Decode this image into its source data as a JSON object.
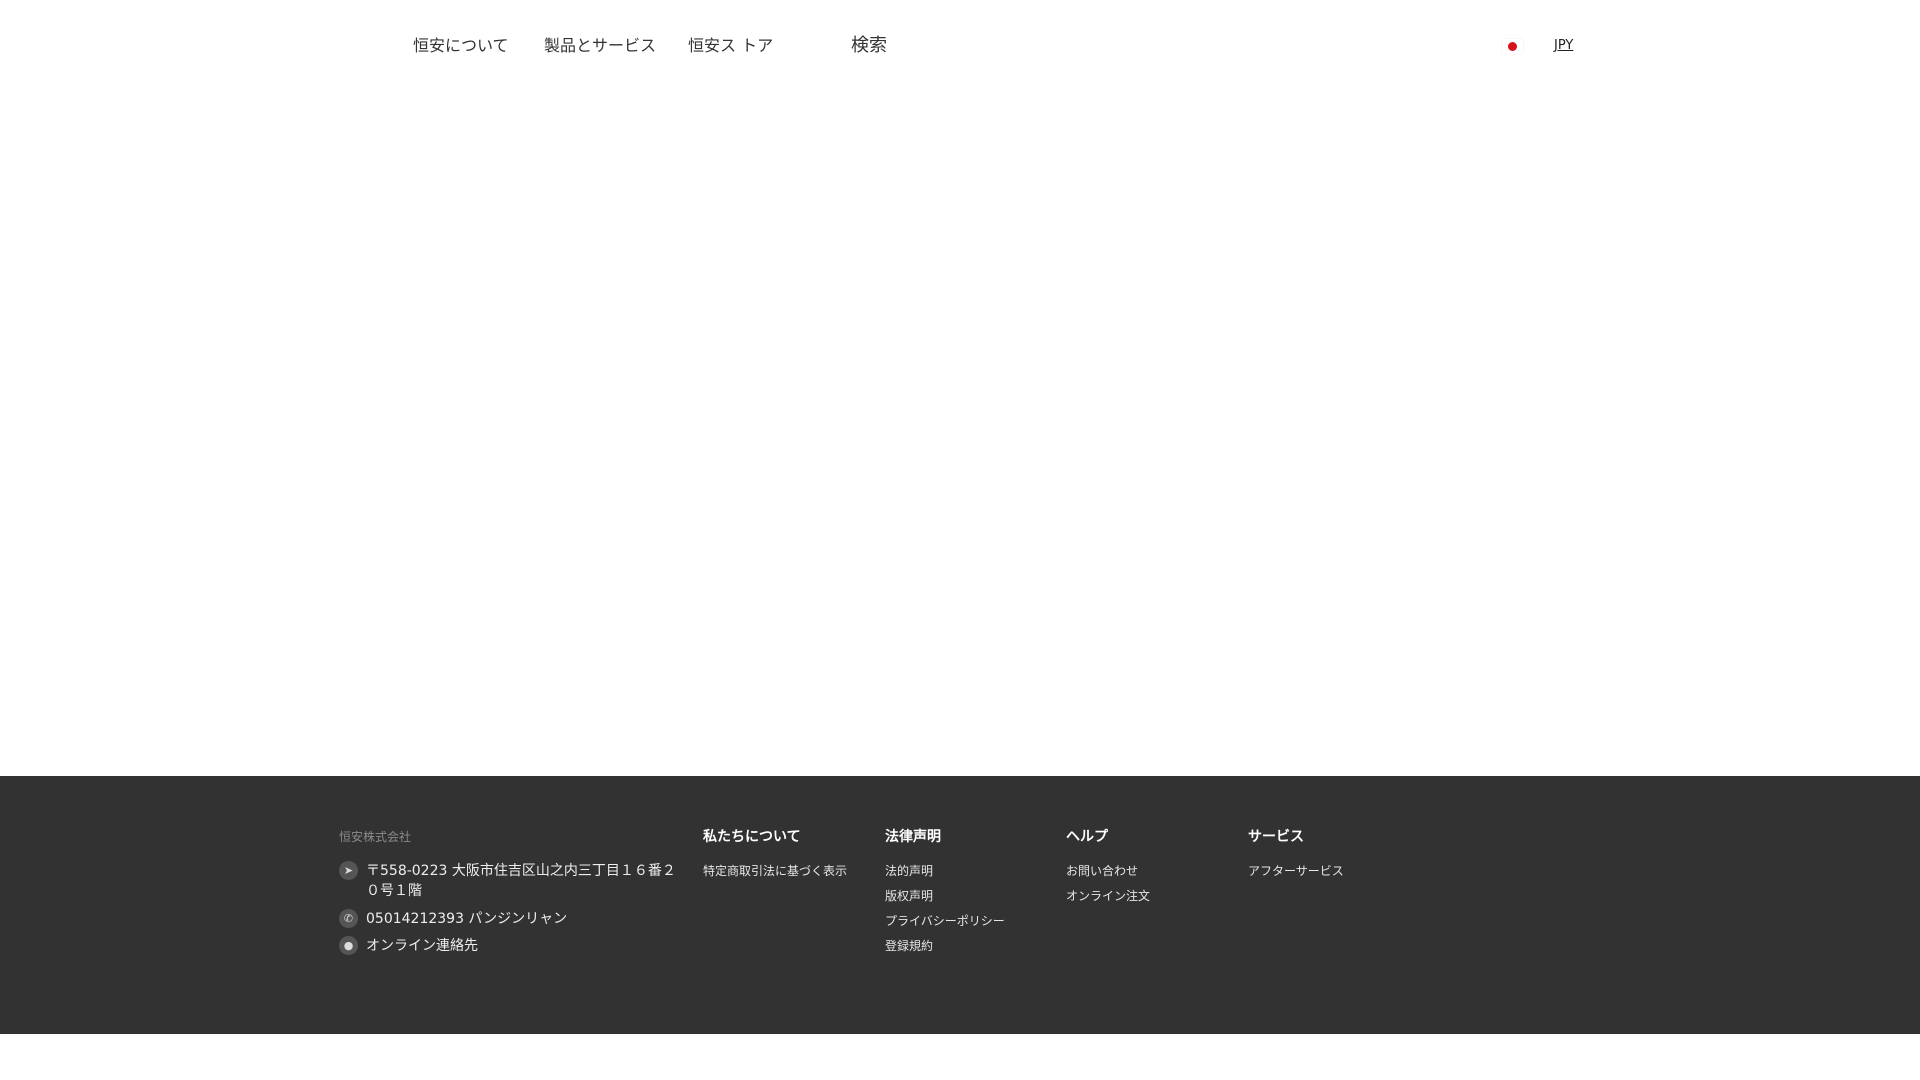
{
  "header": {
    "nav": [
      "恒安について",
      "製品とサービス",
      "恒安ス トア"
    ],
    "search_label": "検索",
    "currency": "JPY",
    "flag_icon": "japan-flag-icon"
  },
  "footer": {
    "company": "恒安株式会社",
    "contact": {
      "address": "〒558-0223 大阪市住吉区山之内三丁目１６番２０号１階",
      "phone": "05014212393 パンジンリャン",
      "online": "オンライン連絡先"
    },
    "columns": [
      {
        "title": "私たちについて",
        "items": [
          "特定商取引法に基づく表示"
        ]
      },
      {
        "title": "法律声明",
        "items": [
          "法的声明",
          "版权声明",
          "プライバシーポリシー",
          "登録規約"
        ]
      },
      {
        "title": "ヘルプ",
        "items": [
          "お問い合わせ",
          "オンライン注文"
        ]
      },
      {
        "title": "サービス",
        "items": [
          "アフターサービス"
        ]
      }
    ]
  }
}
